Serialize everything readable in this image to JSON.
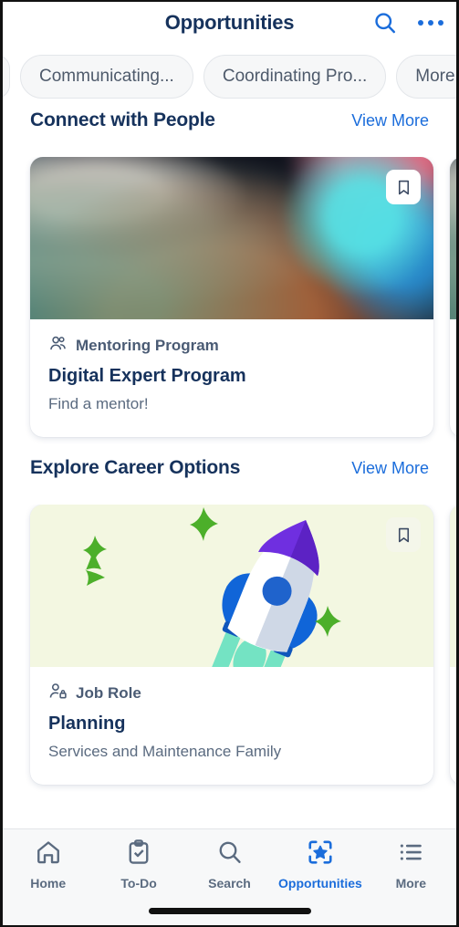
{
  "header": {
    "title": "Opportunities",
    "search_icon": "search-icon",
    "overflow_icon": "more-horizontal-icon"
  },
  "filters": {
    "chips": [
      {
        "label": "Communicating...",
        "truncated": true
      },
      {
        "label": "Coordinating Pro...",
        "truncated": true
      },
      {
        "label": "More",
        "truncated": false
      }
    ],
    "partial_left_chip_visible": true
  },
  "sections": [
    {
      "title": "Connect with People",
      "view_more_label": "View More",
      "cards": [
        {
          "media_type": "photo",
          "media_alt": "blurred-portrait-photo",
          "bookmark_icon": "bookmark-icon",
          "kicker_icon": "two-people-icon",
          "kicker": "Mentoring Program",
          "title": "Digital Expert Program",
          "subtitle": "Find a mentor!"
        },
        {
          "media_type": "photo",
          "media_alt": "blurred-photo-peek",
          "bookmark_icon": "bookmark-icon",
          "kicker_icon": "two-people-icon",
          "kicker": "",
          "title": "",
          "subtitle": ""
        }
      ]
    },
    {
      "title": "Explore Career Options",
      "view_more_label": "View More",
      "cards": [
        {
          "media_type": "illustration",
          "media_alt": "rocket-launch-illustration",
          "bookmark_icon": "bookmark-icon",
          "kicker_icon": "person-lock-icon",
          "kicker": "Job Role",
          "title": "Planning",
          "subtitle": "Services and Maintenance Family"
        },
        {
          "media_type": "illustration",
          "media_alt": "illustration-peek",
          "bookmark_icon": "bookmark-icon",
          "kicker_icon": "person-lock-icon",
          "kicker": "",
          "title": "",
          "subtitle": ""
        }
      ]
    }
  ],
  "tabbar": {
    "items": [
      {
        "label": "Home",
        "icon": "home-icon",
        "active": false
      },
      {
        "label": "To-Do",
        "icon": "clipboard-check-icon",
        "active": false
      },
      {
        "label": "Search",
        "icon": "search-icon",
        "active": false
      },
      {
        "label": "Opportunities",
        "icon": "star-scan-icon",
        "active": true
      },
      {
        "label": "More",
        "icon": "list-bullet-icon",
        "active": false
      }
    ]
  },
  "colors": {
    "accent_blue": "#1b6ddb",
    "text_dark": "#16325c",
    "text_muted": "#5b6b80",
    "chip_bg": "#f6f7f8",
    "illustration_bg": "#f3f7e1",
    "tabbar_bg": "#f7f8f9",
    "rocket_nose": "#6f2fe0",
    "rocket_fin": "#1065d8",
    "flame": "#74e3c3",
    "star_green": "#4caf2a"
  }
}
